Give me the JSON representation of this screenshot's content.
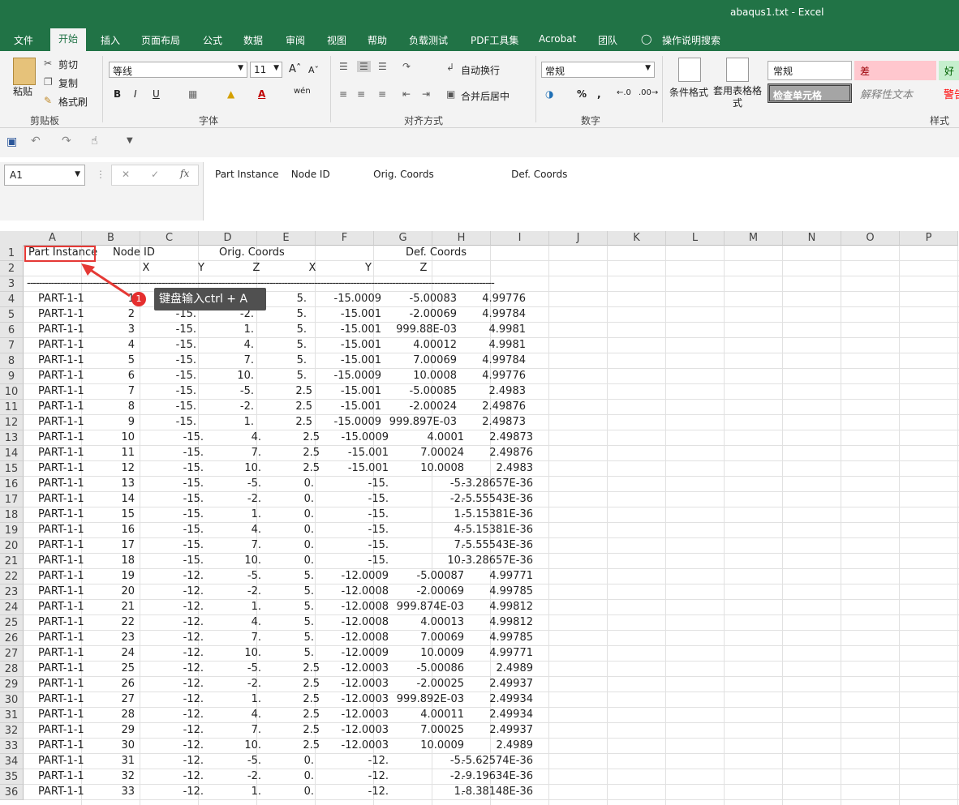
{
  "window": {
    "title": "abaqus1.txt  -  Excel"
  },
  "menu": [
    "文件",
    "开始",
    "插入",
    "页面布局",
    "公式",
    "数据",
    "审阅",
    "视图",
    "帮助",
    "负载测试",
    "PDF工具集",
    "Acrobat",
    "团队",
    "操作说明搜索"
  ],
  "ribbon": {
    "clipboard": {
      "paste": "粘贴",
      "cut": "剪切",
      "copy": "复制",
      "format_painter": "格式刷",
      "group": "剪贴板"
    },
    "font": {
      "name": "等线",
      "size": "11",
      "group": "字体"
    },
    "alignment": {
      "wrap": "自动换行",
      "merge": "合并后居中",
      "group": "对齐方式"
    },
    "number": {
      "format": "常规",
      "group": "数字"
    },
    "styles": {
      "cond_format": "条件格式",
      "table_format": "套用表格格式",
      "normal": "常规",
      "bad": "差",
      "good": "好",
      "check_cell": "检查单元格",
      "explain": "解释性文本",
      "warn": "警告",
      "group": "样式"
    }
  },
  "formula_bar": {
    "name_box": "A1",
    "content": "Part Instance    Node ID              Orig. Coords                         Def. Coords"
  },
  "columns": [
    "A",
    "B",
    "C",
    "D",
    "E",
    "F",
    "G",
    "H",
    "I",
    "J",
    "K",
    "L",
    "M",
    "N",
    "O",
    "P"
  ],
  "header_rows": {
    "r1": [
      "Part Instance",
      "Node ID",
      "Orig. Coords",
      "Def. Coords"
    ],
    "r2": [
      "X",
      "Y",
      "Z",
      "X",
      "Y",
      "Z"
    ],
    "r3": "------------------------------------------------------------------------------------------------------------------------------------------------------------"
  },
  "rows": [
    [
      "PART-1-1",
      "1",
      "-15.",
      "-5.",
      "5.",
      "-15.0009",
      "-5.00083",
      "4.99776"
    ],
    [
      "PART-1-1",
      "2",
      "-15.",
      "-2.",
      "5.",
      "-15.001",
      "-2.00069",
      "4.99784"
    ],
    [
      "PART-1-1",
      "3",
      "-15.",
      "1.",
      "5.",
      "-15.001",
      "999.88E-03",
      "4.9981"
    ],
    [
      "PART-1-1",
      "4",
      "-15.",
      "4.",
      "5.",
      "-15.001",
      "4.00012",
      "4.9981"
    ],
    [
      "PART-1-1",
      "5",
      "-15.",
      "7.",
      "5.",
      "-15.001",
      "7.00069",
      "4.99784"
    ],
    [
      "PART-1-1",
      "6",
      "-15.",
      "10.",
      "5.",
      "-15.0009",
      "10.0008",
      "4.99776"
    ],
    [
      "PART-1-1",
      "7",
      "-15.",
      "-5.",
      "2.5",
      "-15.001",
      "-5.00085",
      "2.4983"
    ],
    [
      "PART-1-1",
      "8",
      "-15.",
      "-2.",
      "2.5",
      "-15.001",
      "-2.00024",
      "2.49876"
    ],
    [
      "PART-1-1",
      "9",
      "-15.",
      "1.",
      "2.5",
      "-15.0009",
      "999.897E-03",
      "2.49873"
    ],
    [
      "PART-1-1",
      "10",
      "-15.",
      "4.",
      "2.5",
      "-15.0009",
      "4.0001",
      "2.49873"
    ],
    [
      "PART-1-1",
      "11",
      "-15.",
      "7.",
      "2.5",
      "-15.001",
      "7.00024",
      "2.49876"
    ],
    [
      "PART-1-1",
      "12",
      "-15.",
      "10.",
      "2.5",
      "-15.001",
      "10.0008",
      "2.4983"
    ],
    [
      "PART-1-1",
      "13",
      "-15.",
      "-5.",
      "0.",
      "-15.",
      "-5.",
      "-3.28657E-36"
    ],
    [
      "PART-1-1",
      "14",
      "-15.",
      "-2.",
      "0.",
      "-15.",
      "-2.",
      "-5.55543E-36"
    ],
    [
      "PART-1-1",
      "15",
      "-15.",
      "1.",
      "0.",
      "-15.",
      "1.",
      "-5.15381E-36"
    ],
    [
      "PART-1-1",
      "16",
      "-15.",
      "4.",
      "0.",
      "-15.",
      "4.",
      "-5.15381E-36"
    ],
    [
      "PART-1-1",
      "17",
      "-15.",
      "7.",
      "0.",
      "-15.",
      "7.",
      "-5.55543E-36"
    ],
    [
      "PART-1-1",
      "18",
      "-15.",
      "10.",
      "0.",
      "-15.",
      "10.",
      "-3.28657E-36"
    ],
    [
      "PART-1-1",
      "19",
      "-12.",
      "-5.",
      "5.",
      "-12.0009",
      "-5.00087",
      "4.99771"
    ],
    [
      "PART-1-1",
      "20",
      "-12.",
      "-2.",
      "5.",
      "-12.0008",
      "-2.00069",
      "4.99785"
    ],
    [
      "PART-1-1",
      "21",
      "-12.",
      "1.",
      "5.",
      "-12.0008",
      "999.874E-03",
      "4.99812"
    ],
    [
      "PART-1-1",
      "22",
      "-12.",
      "4.",
      "5.",
      "-12.0008",
      "4.00013",
      "4.99812"
    ],
    [
      "PART-1-1",
      "23",
      "-12.",
      "7.",
      "5.",
      "-12.0008",
      "7.00069",
      "4.99785"
    ],
    [
      "PART-1-1",
      "24",
      "-12.",
      "10.",
      "5.",
      "-12.0009",
      "10.0009",
      "4.99771"
    ],
    [
      "PART-1-1",
      "25",
      "-12.",
      "-5.",
      "2.5",
      "-12.0003",
      "-5.00086",
      "2.4989"
    ],
    [
      "PART-1-1",
      "26",
      "-12.",
      "-2.",
      "2.5",
      "-12.0003",
      "-2.00025",
      "2.49937"
    ],
    [
      "PART-1-1",
      "27",
      "-12.",
      "1.",
      "2.5",
      "-12.0003",
      "999.892E-03",
      "2.49934"
    ],
    [
      "PART-1-1",
      "28",
      "-12.",
      "4.",
      "2.5",
      "-12.0003",
      "4.00011",
      "2.49934"
    ],
    [
      "PART-1-1",
      "29",
      "-12.",
      "7.",
      "2.5",
      "-12.0003",
      "7.00025",
      "2.49937"
    ],
    [
      "PART-1-1",
      "30",
      "-12.",
      "10.",
      "2.5",
      "-12.0003",
      "10.0009",
      "2.4989"
    ],
    [
      "PART-1-1",
      "31",
      "-12.",
      "-5.",
      "0.",
      "-12.",
      "-5.",
      "-5.62574E-36"
    ],
    [
      "PART-1-1",
      "32",
      "-12.",
      "-2.",
      "0.",
      "-12.",
      "-2.",
      "-9.19634E-36"
    ],
    [
      "PART-1-1",
      "33",
      "-12.",
      "1.",
      "0.",
      "-12.",
      "1.",
      "-8.38148E-36"
    ]
  ],
  "annotation": {
    "badge": "1",
    "text": "键盘输入ctrl + A"
  }
}
